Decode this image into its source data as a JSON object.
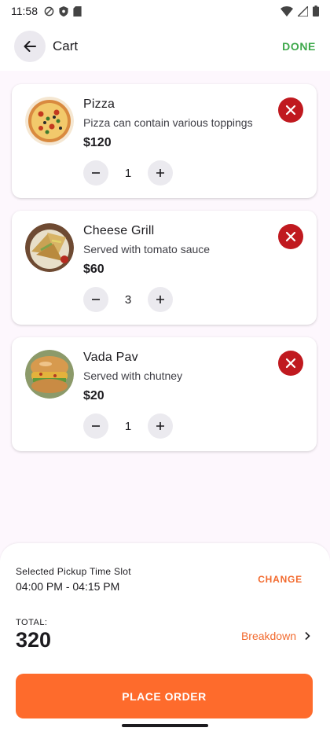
{
  "status_bar": {
    "time": "11:58"
  },
  "header": {
    "title": "Cart",
    "done_label": "DONE"
  },
  "cart": {
    "items": [
      {
        "name": "Pizza",
        "description": "Pizza can contain various toppings",
        "price": "$120",
        "quantity": "1"
      },
      {
        "name": "Cheese Grill",
        "description": "Served with tomato sauce",
        "price": "$60",
        "quantity": "3"
      },
      {
        "name": "Vada Pav",
        "description": "Served with chutney",
        "price": "$20",
        "quantity": "1"
      }
    ]
  },
  "pickup": {
    "label": "Selected Pickup Time Slot",
    "value": "04:00 PM - 04:15 PM",
    "change_label": "CHANGE"
  },
  "total": {
    "label": "TOTAL:",
    "value": "320",
    "breakdown_label": "Breakdown"
  },
  "place_order_label": "PLACE ORDER",
  "colors": {
    "accent": "#fe6b2c",
    "done_green": "#3ea84b",
    "remove_red": "#c0191f",
    "background": "#fdf7fd"
  }
}
